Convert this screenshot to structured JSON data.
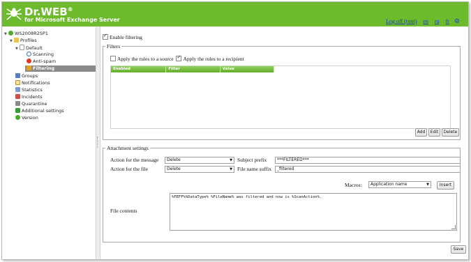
{
  "header": {
    "brand": "Dr.WEB",
    "brand_mark": "®",
    "subtitle": "for Microsoft Exchange Server",
    "logout": "Log off (root)",
    "lang_en": "en",
    "lang_ru": "ru",
    "lang_fr": "fr",
    "settings_icon": "gear-icon",
    "accent": "#6dbb2d"
  },
  "tree": {
    "server": "WS2008R2SP1",
    "profiles": "Profiles",
    "default": "Default",
    "scanning": "Scanning",
    "antispam": "Anti-spam",
    "filtering": "Filtering",
    "groups": "Groups",
    "notifications": "Notifications",
    "statistics": "Statistics",
    "incidents": "Incidents",
    "quarantine": "Quarantine",
    "additional": "Additional settings",
    "version": "Version"
  },
  "filtering": {
    "enable_label": "Enable filtering",
    "enabled": true
  },
  "filters": {
    "legend": "Filters",
    "source_label": "Apply the rules to a source",
    "source_checked": false,
    "recipient_label": "Apply the rules to a recipient",
    "recipient_checked": true,
    "columns": [
      "Enabled",
      "Filter",
      "Value"
    ],
    "add": "Add",
    "edit": "Edit",
    "delete": "Delete"
  },
  "attachment": {
    "legend": "Attachment settings",
    "action_message_label": "Action for the message",
    "action_message_value": "Delete",
    "subject_prefix_label": "Subject prefix",
    "subject_prefix_value": "***FILTERED***",
    "action_file_label": "Action for the file",
    "action_file_value": "Delete",
    "suffix_label": "File name suffix",
    "suffix_value": "_filtered",
    "macros_label": "Macros:",
    "macros_value": "Application name",
    "insert": "Insert",
    "file_contents_label": "File contents",
    "file_contents_value": "%FEFF%%DataType% %FileName% was filtered and now is %ScanAction%."
  },
  "save": "Save"
}
